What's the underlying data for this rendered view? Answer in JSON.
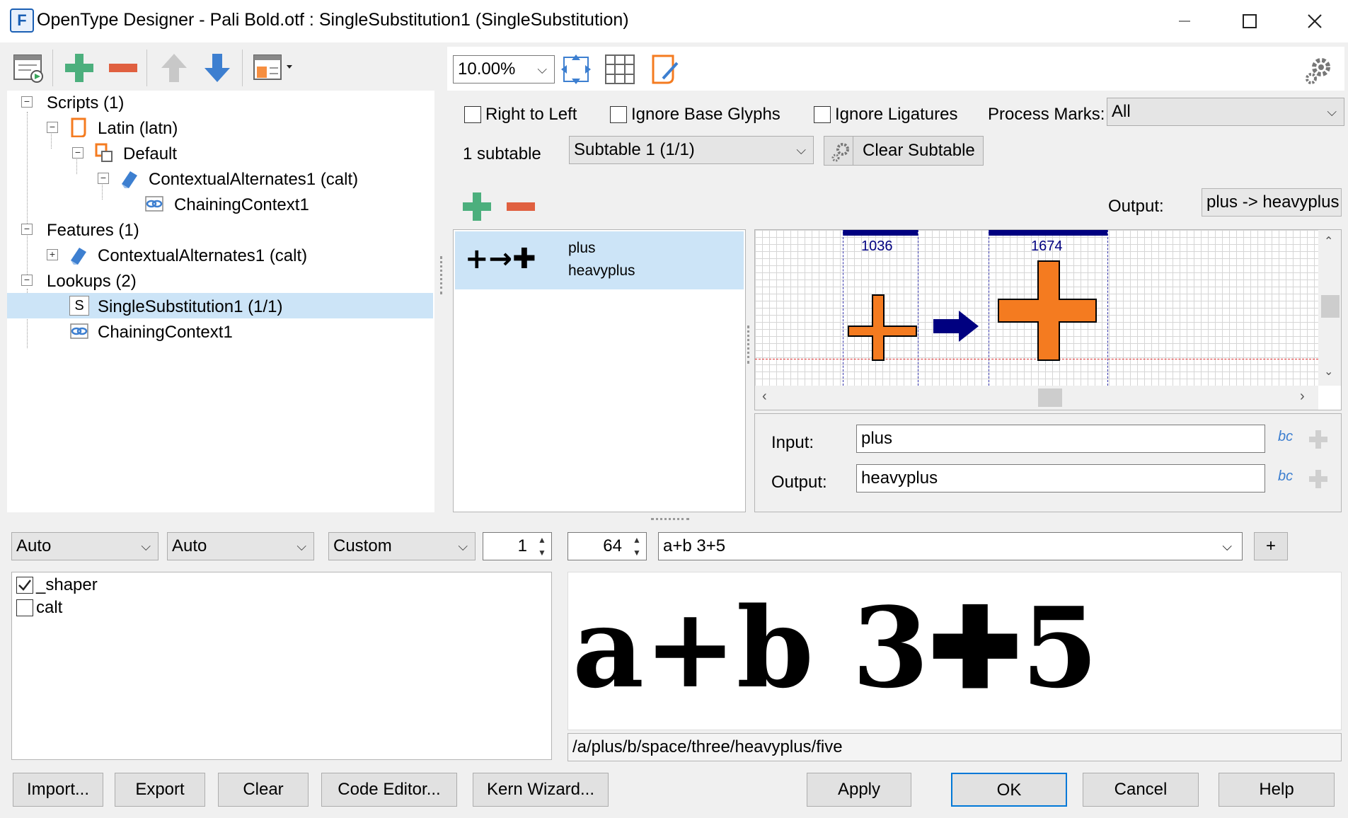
{
  "window": {
    "title": "OpenType Designer - Pali Bold.otf : SingleSubstitution1 (SingleSubstitution)",
    "app_icon_letter": "F"
  },
  "left_tree": [
    {
      "label": "Scripts (1)",
      "icon": "none",
      "expander": "−"
    },
    {
      "label": "Latin (latn)",
      "icon": "script-icon",
      "expander": "−"
    },
    {
      "label": "Default",
      "icon": "language-icon",
      "expander": "−"
    },
    {
      "label": "ContextualAlternates1 (calt)",
      "icon": "feature-icon",
      "expander": "−"
    },
    {
      "label": "ChainingContext1",
      "icon": "chaining-lookup-icon",
      "expander": ""
    },
    {
      "label": "Features (1)",
      "icon": "none",
      "expander": "−"
    },
    {
      "label": "ContextualAlternates1 (calt)",
      "icon": "feature-icon",
      "expander": "+"
    },
    {
      "label": "Lookups (2)",
      "icon": "none",
      "expander": "−"
    },
    {
      "label": "SingleSubstitution1 (1/1)",
      "icon": "single-lookup-icon",
      "expander": "",
      "selected": true,
      "icon_letter": "S"
    },
    {
      "label": "ChainingContext1",
      "icon": "chaining-lookup-icon",
      "expander": ""
    }
  ],
  "top_toolbar": {
    "zoom": "10.00%"
  },
  "lookup_flags": {
    "right_to_left": "Right to Left",
    "ignore_base": "Ignore Base Glyphs",
    "ignore_ligatures": "Ignore Ligatures",
    "process_marks_label": "Process Marks:",
    "process_marks_value": "All"
  },
  "subtable": {
    "count": "1 subtable",
    "selected": "Subtable 1 (1/1)",
    "clear_label": "Clear Subtable"
  },
  "output_summary": {
    "label": "Output:",
    "value": "plus -> heavyplus"
  },
  "rules": [
    {
      "input": "plus",
      "output": "heavyplus",
      "preview": "+→✚"
    }
  ],
  "glyph_preview": {
    "left_width": "1036",
    "right_width": "1674"
  },
  "edit": {
    "input_label": "Input:",
    "input_value": "plus",
    "output_label": "Output:",
    "output_value": "heavyplus",
    "bc_glyph": "bc"
  },
  "test_bar": {
    "script": "Auto",
    "language": "Auto",
    "direction": "Custom",
    "spin1": "1",
    "size": "64",
    "text": "a+b 3+5",
    "add": "+"
  },
  "features_list": [
    {
      "tag": "_shaper",
      "checked": true
    },
    {
      "tag": "calt",
      "checked": false
    }
  ],
  "preview": {
    "rendered": "a+b 3✚5",
    "glyph_string": "/a/plus/b/space/three/heavyplus/five"
  },
  "buttons": {
    "import": "Import...",
    "export": "Export",
    "clear": "Clear",
    "code_editor": "Code Editor...",
    "kern_wizard": "Kern Wizard...",
    "apply": "Apply",
    "ok": "OK",
    "cancel": "Cancel",
    "help": "Help"
  },
  "colors": {
    "accent_orange": "#f47b20",
    "plus_green": "#4caf7d",
    "minus_red": "#e06040",
    "arrow_blue": "#3d7fd0",
    "selection": "#cce4f7",
    "glyph_navy": "#000080"
  }
}
